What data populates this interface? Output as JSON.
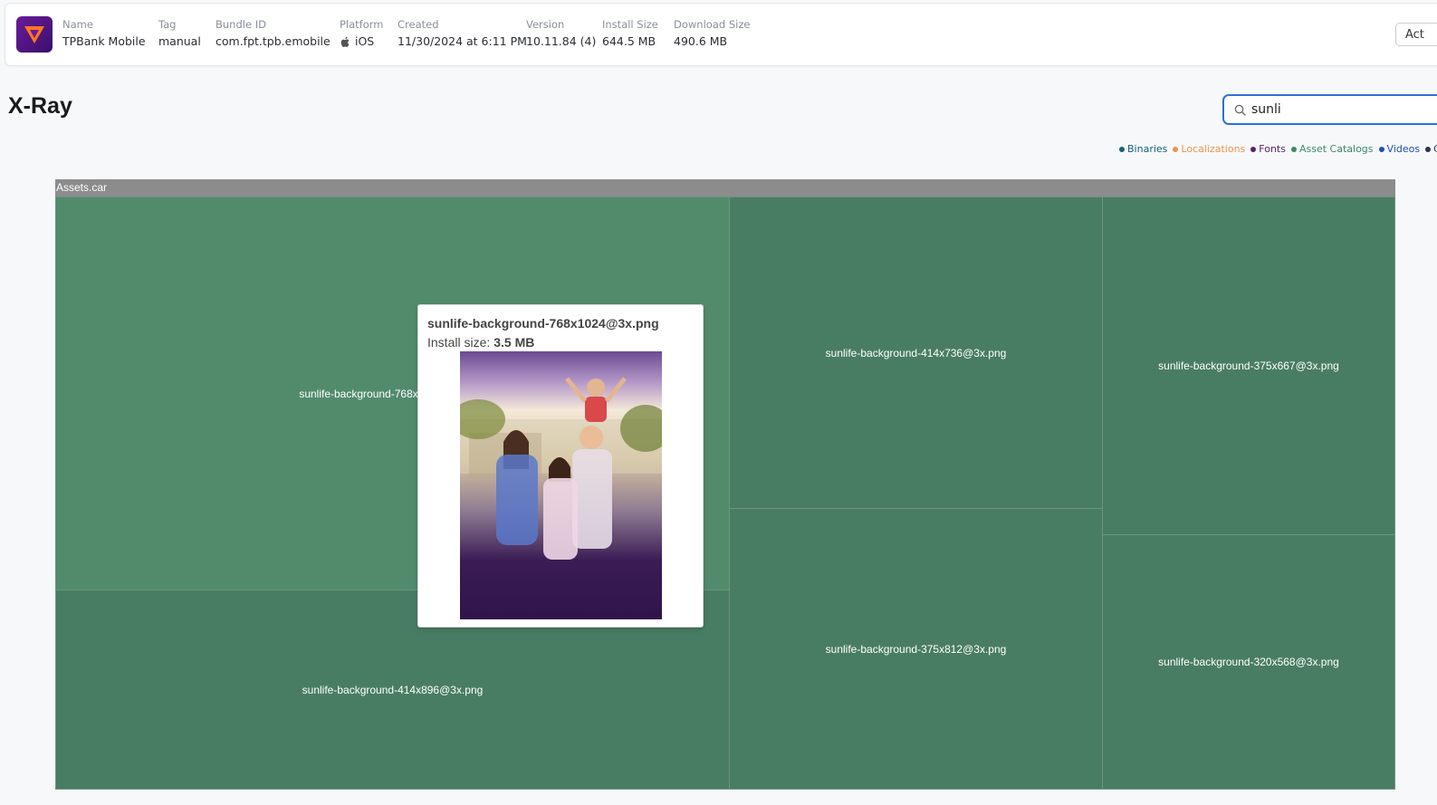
{
  "header": {
    "fields": [
      {
        "label": "Name",
        "value": "TPBank Mobile"
      },
      {
        "label": "Tag",
        "value": "manual"
      },
      {
        "label": "Bundle ID",
        "value": "com.fpt.tpb.emobile"
      },
      {
        "label": "Platform",
        "value": "iOS"
      },
      {
        "label": "Created",
        "value": "11/30/2024 at 6:11 PM"
      },
      {
        "label": "Version",
        "value": "10.11.84 (4)"
      },
      {
        "label": "Install Size",
        "value": "644.5 MB"
      },
      {
        "label": "Download Size",
        "value": "490.6 MB"
      }
    ],
    "action_label": "Act"
  },
  "page": {
    "title": "X-Ray"
  },
  "search": {
    "value": "sunli"
  },
  "legend": [
    {
      "label": "Binaries",
      "color": "#14607a"
    },
    {
      "label": "Localizations",
      "color": "#f0924a"
    },
    {
      "label": "Fonts",
      "color": "#5c1f6e"
    },
    {
      "label": "Asset Catalogs",
      "color": "#3e8a68"
    },
    {
      "label": "Videos",
      "color": "#1f4fb3"
    },
    {
      "label": "Co",
      "color": "#2a3550"
    }
  ],
  "treemap": {
    "root": "Assets.car",
    "cells": [
      {
        "label": "sunlife-background-768x1024@3x.png",
        "color": "#528b6c"
      },
      {
        "label": "sunlife-background-414x896@3x.png",
        "color": "#497d63"
      },
      {
        "label": "sunlife-background-414x736@3x.png",
        "color": "#497d63"
      },
      {
        "label": "sunlife-background-375x812@3x.png",
        "color": "#497d63"
      },
      {
        "label": "sunlife-background-375x667@3x.png",
        "color": "#497d63"
      },
      {
        "label": "sunlife-background-320x568@3x.png",
        "color": "#497d63"
      }
    ]
  },
  "tooltip": {
    "title": "sunlife-background-768x1024@3x.png",
    "size_label": "Install size:",
    "size_value": "3.5 MB"
  }
}
